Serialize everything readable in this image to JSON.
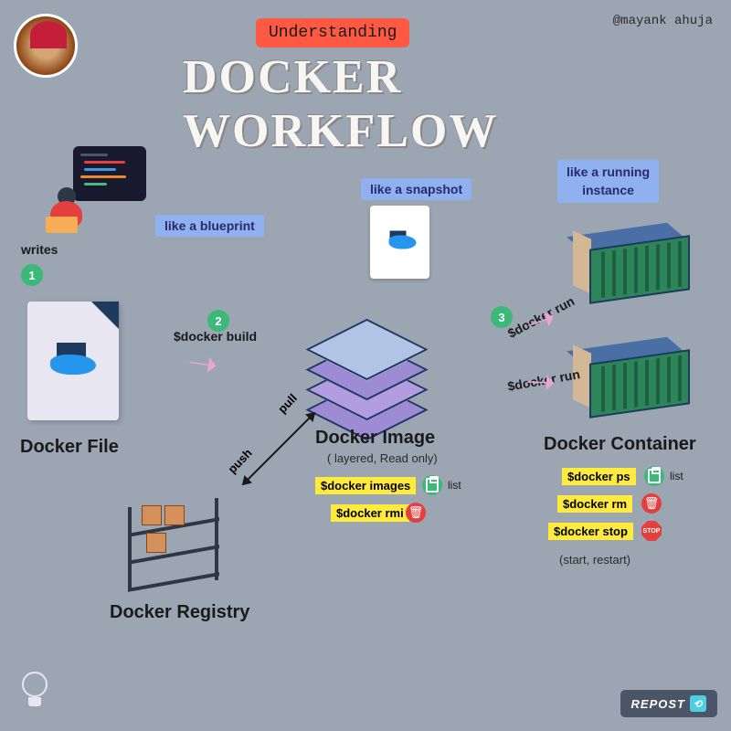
{
  "header": {
    "subtitle": "Understanding",
    "title": "DOCKER WORKFLOW",
    "attribution": "@mayank ahuja"
  },
  "tags": {
    "blueprint": "like a blueprint",
    "snapshot": "like a snapshot",
    "running": "like a running\ninstance"
  },
  "steps": {
    "one": "1",
    "two": "2",
    "three": "3",
    "writes": "writes"
  },
  "labels": {
    "dockerfile": "Docker File",
    "image": "Docker Image",
    "image_sub": "( layered, Read only)",
    "container": "Docker Container",
    "container_sub": "(start, restart)",
    "registry": "Docker Registry"
  },
  "commands": {
    "build": "$docker build",
    "run": "$docker run",
    "images": "$docker images",
    "rmi": "$docker rmi",
    "ps": "$docker ps",
    "rm": "$docker rm",
    "stop": "$docker stop"
  },
  "arrows": {
    "pull": "pull",
    "push": "push"
  },
  "icons": {
    "list": "list",
    "stop": "STOP"
  },
  "footer": {
    "repost": "REPOST"
  }
}
